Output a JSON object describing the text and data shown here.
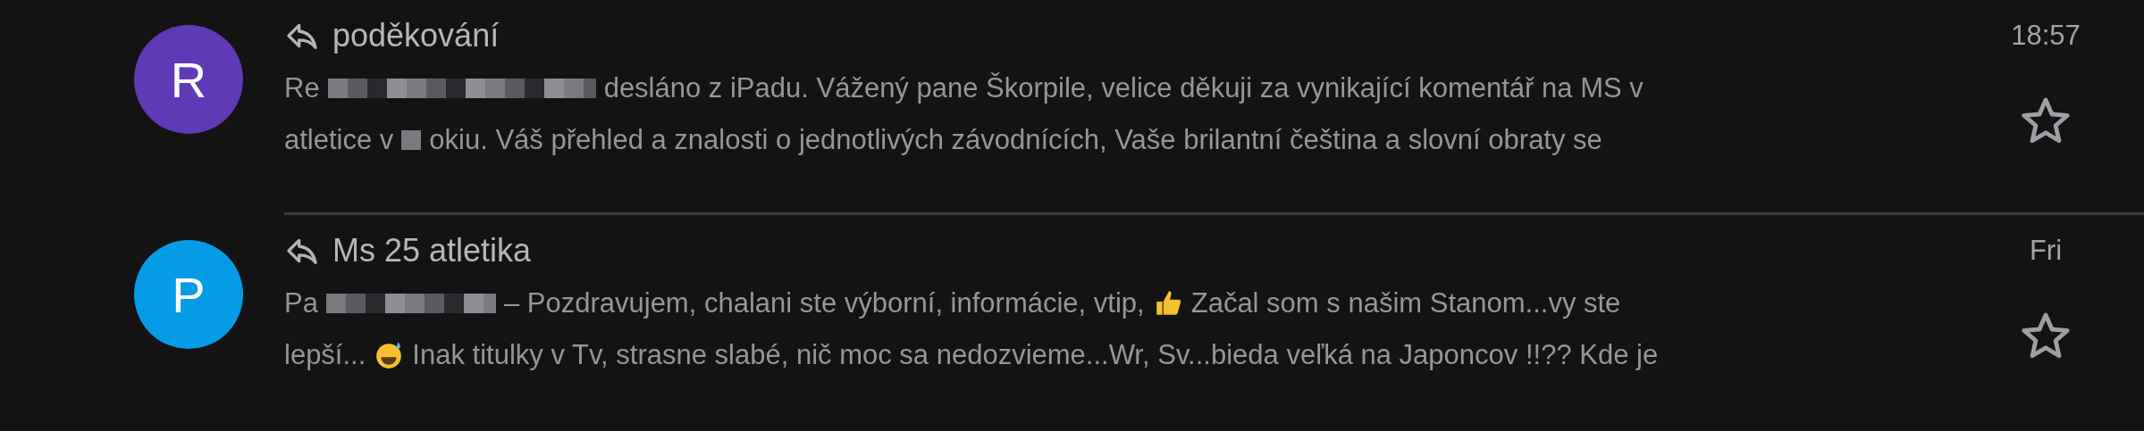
{
  "messages": [
    {
      "avatar": {
        "letter": "R",
        "color": "#6039b6"
      },
      "replied": true,
      "subject": "poděkování",
      "time": "18:57",
      "starred": false,
      "snippet_lines": [
        [
          {
            "kind": "text",
            "text": "Re"
          },
          {
            "kind": "redacted-long"
          },
          {
            "kind": "text",
            "text": "desláno z iPadu. Vážený pane Škorpile, velice děkuji za vynikající komentář na MS v"
          }
        ],
        [
          {
            "kind": "text",
            "text": "atletice v"
          },
          {
            "kind": "redacted-short"
          },
          {
            "kind": "text",
            "text": "okiu. Váš přehled a znalosti o jednotlivých závodnících, Vaše brilantní čeština a slovní obraty se"
          }
        ]
      ]
    },
    {
      "avatar": {
        "letter": "P",
        "color": "#049ce6"
      },
      "replied": true,
      "subject": "Ms 25 atletika",
      "time": "Fri",
      "starred": false,
      "snippet_lines": [
        [
          {
            "kind": "text",
            "text": "Pa"
          },
          {
            "kind": "redacted-medium"
          },
          {
            "kind": "text",
            "text": "– Pozdravujem, chalani ste výborní, informácie, vtip,"
          },
          {
            "kind": "emoji-thumbs"
          },
          {
            "kind": "text",
            "text": "Začal som s našim Stanom...vy ste"
          }
        ],
        [
          {
            "kind": "text",
            "text": "lepší..."
          },
          {
            "kind": "emoji-sweat"
          },
          {
            "kind": "text",
            "text": "Inak titulky v Tv, strasne slabé, nič moc sa nedozvieme...Wr, Sv...bieda veľká na Japoncov !!?? Kde je"
          }
        ]
      ]
    }
  ]
}
